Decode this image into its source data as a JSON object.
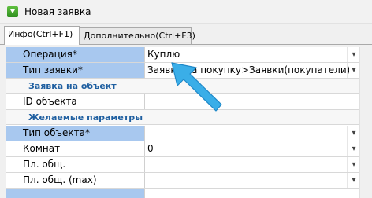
{
  "window": {
    "title": "Новая заявка",
    "icon": "green-download-arrow-icon"
  },
  "tabs": [
    {
      "label": "Инфо(Ctrl+F1)",
      "active": true
    },
    {
      "label": "Дополнительно(Ctrl+F3)",
      "active": false
    }
  ],
  "grid": {
    "operation": {
      "label": "Операция*",
      "value": "Куплю"
    },
    "request_type": {
      "label": "Тип заявки*",
      "value": "Заявки на покупку>Заявки(покупатели)>"
    },
    "section_object": "Заявка на объект",
    "object_id": {
      "label": "ID объекта",
      "value": ""
    },
    "section_desired": "Желаемые параметры",
    "object_type": {
      "label": "Тип объекта*",
      "value": ""
    },
    "rooms": {
      "label": "Комнат",
      "value": "0"
    },
    "area": {
      "label": "Пл. общ.",
      "value": ""
    },
    "area_max": {
      "label": "Пл. общ. (max)",
      "value": ""
    }
  },
  "colors": {
    "required_label_bg": "#a8c8ef",
    "section_text": "#1f5fa0",
    "annotation_arrow": "#3aaee8"
  },
  "icons": {
    "dropdown": "▾"
  }
}
